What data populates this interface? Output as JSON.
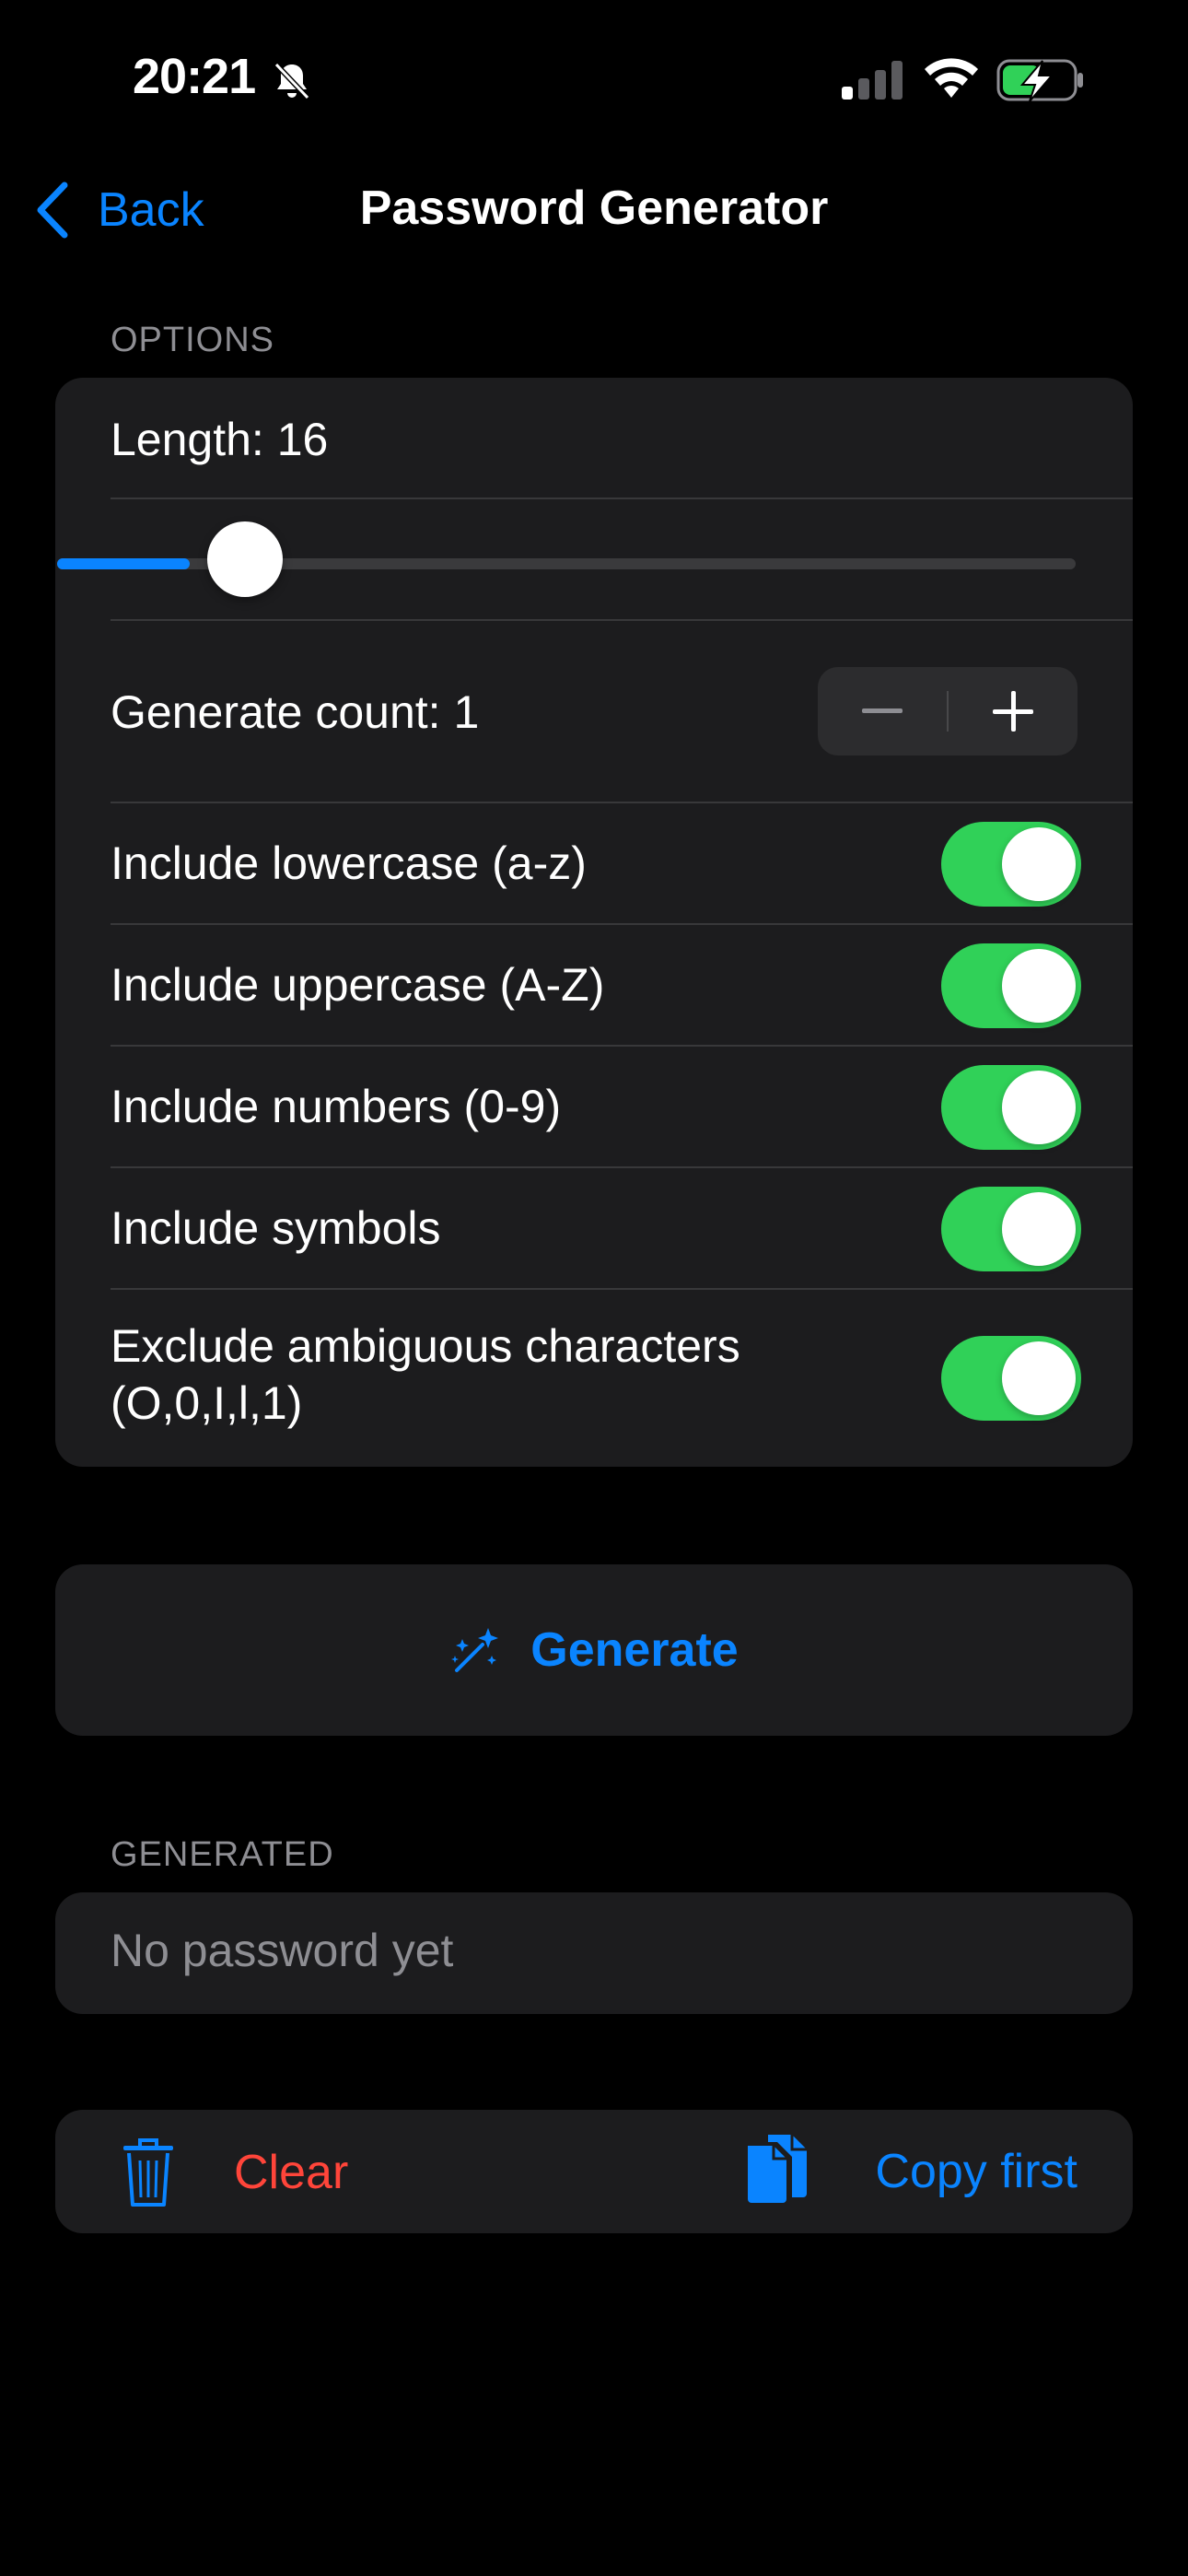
{
  "status_bar": {
    "time": "20:21",
    "bell_icon": "bell-slash-icon",
    "signal_icon": "cellular-signal-icon",
    "wifi_icon": "wifi-icon",
    "battery_icon": "battery-charging-icon"
  },
  "nav": {
    "back_label": "Back",
    "title": "Password Generator"
  },
  "options": {
    "header": "OPTIONS",
    "length_label": "Length: 16",
    "length_slider_fraction": 0.13,
    "generate_count_label": "Generate count: 1",
    "toggles": [
      {
        "label": "Include lowercase (a-z)",
        "on": true
      },
      {
        "label": "Include uppercase (A-Z)",
        "on": true
      },
      {
        "label": "Include numbers (0-9)",
        "on": true
      },
      {
        "label": "Include symbols",
        "on": true
      },
      {
        "label_line1": "Exclude ambiguous characters",
        "label_line2": "(O,0,I,l,1)",
        "on": true
      }
    ]
  },
  "generate_button": {
    "label": "Generate",
    "icon": "magic-wand-icon"
  },
  "generated": {
    "header": "GENERATED",
    "placeholder": "No password yet"
  },
  "actions": {
    "clear_label": "Clear",
    "copy_label": "Copy first"
  },
  "colors": {
    "accent": "#0a84ff",
    "destructive": "#ff453a",
    "toggle_on": "#30d158",
    "card_bg": "#1c1c1e",
    "secondary_text": "#8e8e93"
  }
}
